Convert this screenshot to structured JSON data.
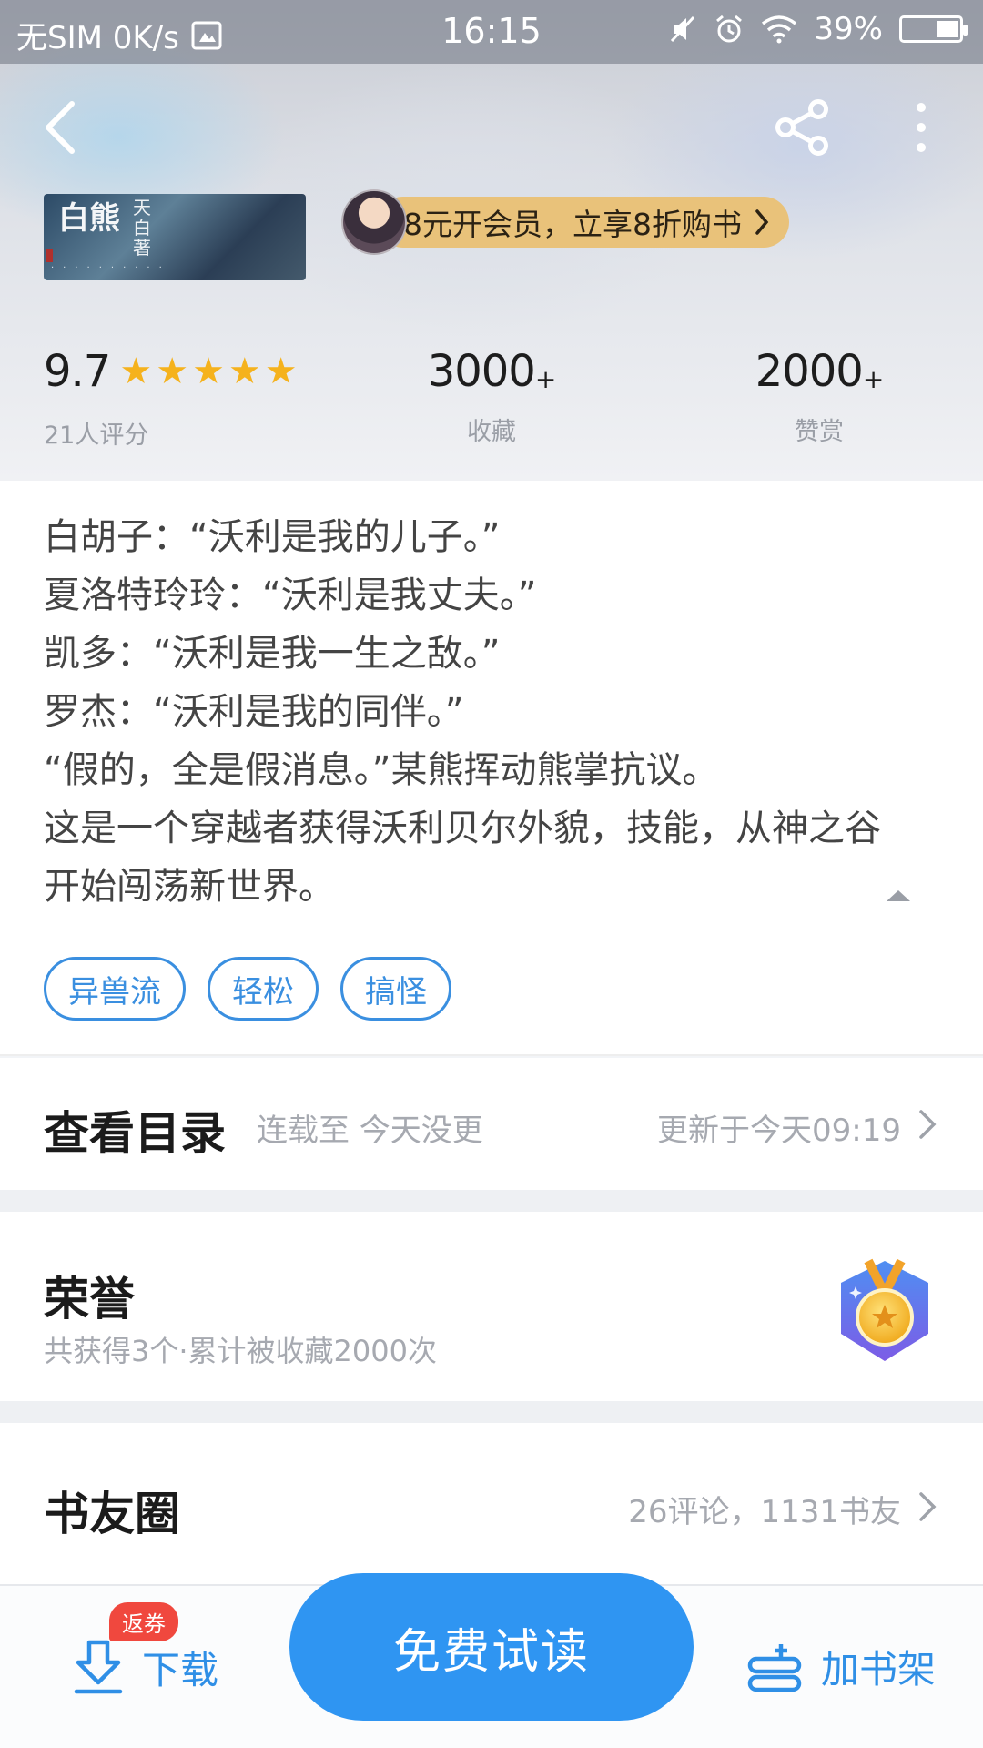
{
  "status_bar": {
    "carrier": "无SIM 0K/s",
    "time": "16:15",
    "battery": "39%",
    "battery_level": 0.39
  },
  "book": {
    "cover_title": "白熊",
    "cover_author": "天白著",
    "vip_banner": "8元开会员，立享8折购书",
    "rating": "9.7",
    "stars": 5,
    "rating_count": "21人评分",
    "collect_count": "3000",
    "collect_label": "收藏",
    "reward_count": "2000",
    "reward_label": "赞赏",
    "plus": "+"
  },
  "intro": {
    "lines": [
      "白胡子：“沃利是我的儿子。”",
      "夏洛特玲玲：“沃利是我丈夫。”",
      "凯多：“沃利是我一生之敌。”",
      "罗杰：“沃利是我的同伴。”",
      "“假的，全是假消息。”某熊挥动熊掌抗议。",
      "这是一个穿越者获得沃利贝尔外貌，技能，从神之谷",
      "开始闯荡新世界。"
    ],
    "tags": [
      "异兽流",
      "轻松",
      "搞怪"
    ]
  },
  "catalog": {
    "title": "查看目录",
    "status": "连载至 今天没更",
    "updated": "更新于今天09:19"
  },
  "honor": {
    "title": "荣誉",
    "subtitle": "共获得3个·累计被收藏2000次"
  },
  "friends": {
    "title": "书友圈",
    "meta": "26评论，1131书友"
  },
  "bottom_bar": {
    "badge": "返券",
    "download": "下载",
    "read": "免费试读",
    "add_shelf": "加书架"
  },
  "colors": {
    "accent": "#2f95f2",
    "star": "#f5b21d",
    "vip_pill": "#e9c27a",
    "badge": "#f0483e"
  }
}
